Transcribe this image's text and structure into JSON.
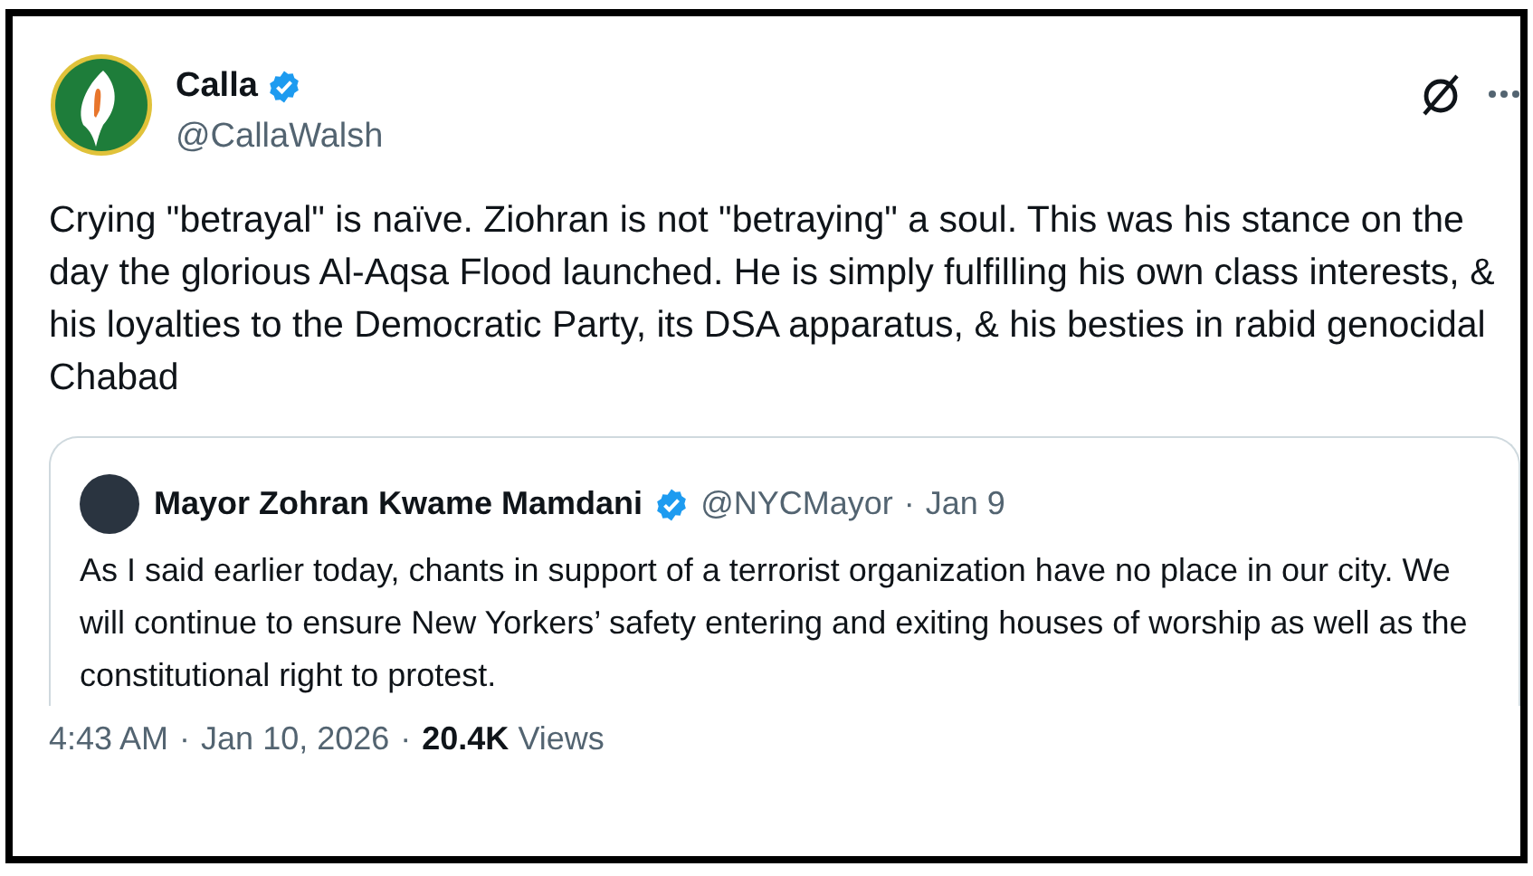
{
  "author": {
    "name": "Calla",
    "verified": true,
    "handle": "@CallaWalsh"
  },
  "text": "Crying \"betrayal\" is naïve. Ziohran is not \"betraying\" a soul. This was his stance on the day the glorious Al-Aqsa Flood launched. He is simply fulfilling his own class interests, & his loyalties to the Democratic Party, its DSA apparatus, & his besties in rabid genocidal Chabad",
  "quote": {
    "name": "Mayor Zohran Kwame Mamdani",
    "verified": true,
    "handle": "@NYCMayor",
    "separator": "·",
    "date": "Jan 9",
    "text": "As I said earlier today, chants in support of a terrorist organization have no place in our city. We will continue to ensure New Yorkers’ safety entering and exiting houses of worship as well as the constitutional right to protest."
  },
  "footer": {
    "time": "4:43 AM",
    "separator_1": "·",
    "date": "Jan 10, 2026",
    "separator_2": "·",
    "views_count": "20.4K",
    "views_label": "Views"
  }
}
